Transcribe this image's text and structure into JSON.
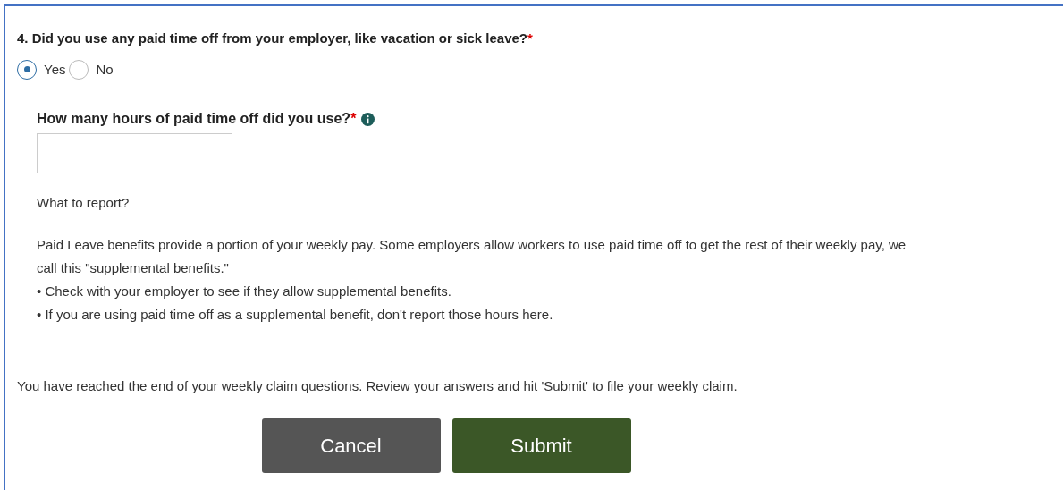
{
  "question": {
    "text": "4. Did you use any paid time off from your employer, like vacation or sick leave?",
    "required_mark": "*"
  },
  "options": [
    {
      "label": "Yes",
      "selected": true
    },
    {
      "label": "No",
      "selected": false
    }
  ],
  "follow_up": {
    "label": "How many hours of paid time off did you use?",
    "required_mark": "*"
  },
  "help_title": "What to report?",
  "help_lines": [
    "Paid Leave benefits provide a portion of your weekly pay. Some employers allow workers to use paid time off to get the rest of their weekly pay, we call this \"supplemental benefits.\"",
    "• Check with your employer to see if they allow supplemental benefits.",
    "• If you are using paid time off as a supplemental benefit, don't report those hours here."
  ],
  "end_note": "You have reached the end of your weekly claim questions. Review your answers and hit 'Submit' to file your weekly claim.",
  "buttons": [
    {
      "label": "Cancel",
      "kind": "secondary"
    },
    {
      "label": "Submit",
      "kind": "primary"
    }
  ]
}
